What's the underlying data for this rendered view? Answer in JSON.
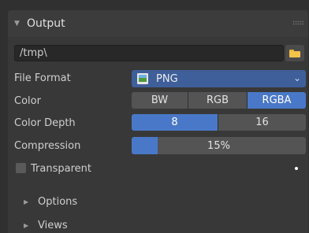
{
  "panel": {
    "title": "Output"
  },
  "output_path": {
    "value": "/tmp\\"
  },
  "file_format": {
    "label": "File Format",
    "value": "PNG"
  },
  "color": {
    "label": "Color",
    "options": [
      "BW",
      "RGB",
      "RGBA"
    ],
    "selected": "RGBA"
  },
  "color_depth": {
    "label": "Color Depth",
    "options": [
      "8",
      "16"
    ],
    "selected": "8"
  },
  "compression": {
    "label": "Compression",
    "value_text": "15%",
    "fraction": 0.15
  },
  "transparent": {
    "label": "Transparent",
    "checked": false
  },
  "subpanels": [
    {
      "label": "Options"
    },
    {
      "label": "Views"
    }
  ],
  "colors": {
    "accent": "#4a78c8",
    "select_bg": "#3f5f9a"
  }
}
